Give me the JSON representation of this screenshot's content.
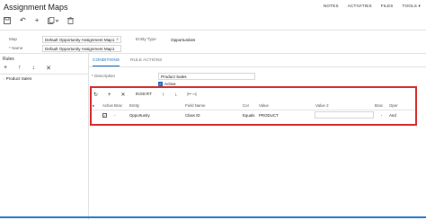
{
  "header": {
    "title": "Assignment Maps",
    "links": [
      "NOTES",
      "ACTIVITIES",
      "FILES",
      "TOOLS ▾"
    ]
  },
  "toolbar": {
    "icons": [
      "save-icon",
      "undo-icon",
      "add-icon",
      "copy-icon",
      "delete-icon"
    ]
  },
  "form": {
    "map_label": "Map",
    "map_value": "Default Opportunity Assignment Map1",
    "name_label": "* Name",
    "name_value": "Default Opportunity Assignment Map1",
    "entity_type_label": "Entity Type",
    "entity_type_value": "Opportunities"
  },
  "rules": {
    "title": "Rules",
    "item": "Product Sales"
  },
  "tabs": [
    "CONDITIONS",
    "RULE ACTIONS"
  ],
  "conditions": {
    "description_label": "* Description",
    "description_value": "Product Sales",
    "active_label": "Active"
  },
  "grid_toolbar": {
    "insert_label": "INSERT"
  },
  "grid": {
    "columns": [
      "Active",
      "Brac",
      "Entity",
      "Field Name",
      "Cor",
      "Value",
      "Value 2",
      "Brac",
      "Oper"
    ],
    "rows": [
      {
        "active": "✓",
        "brac": "-",
        "entity": "Opportunity",
        "field_name": "Class ID",
        "cor": "Equals",
        "value": "PRODUCT",
        "value2": "",
        "brac2": "-",
        "oper": "And"
      }
    ]
  },
  "colors": {
    "accent": "#1f6fbf",
    "highlight": "#d92c2c"
  }
}
